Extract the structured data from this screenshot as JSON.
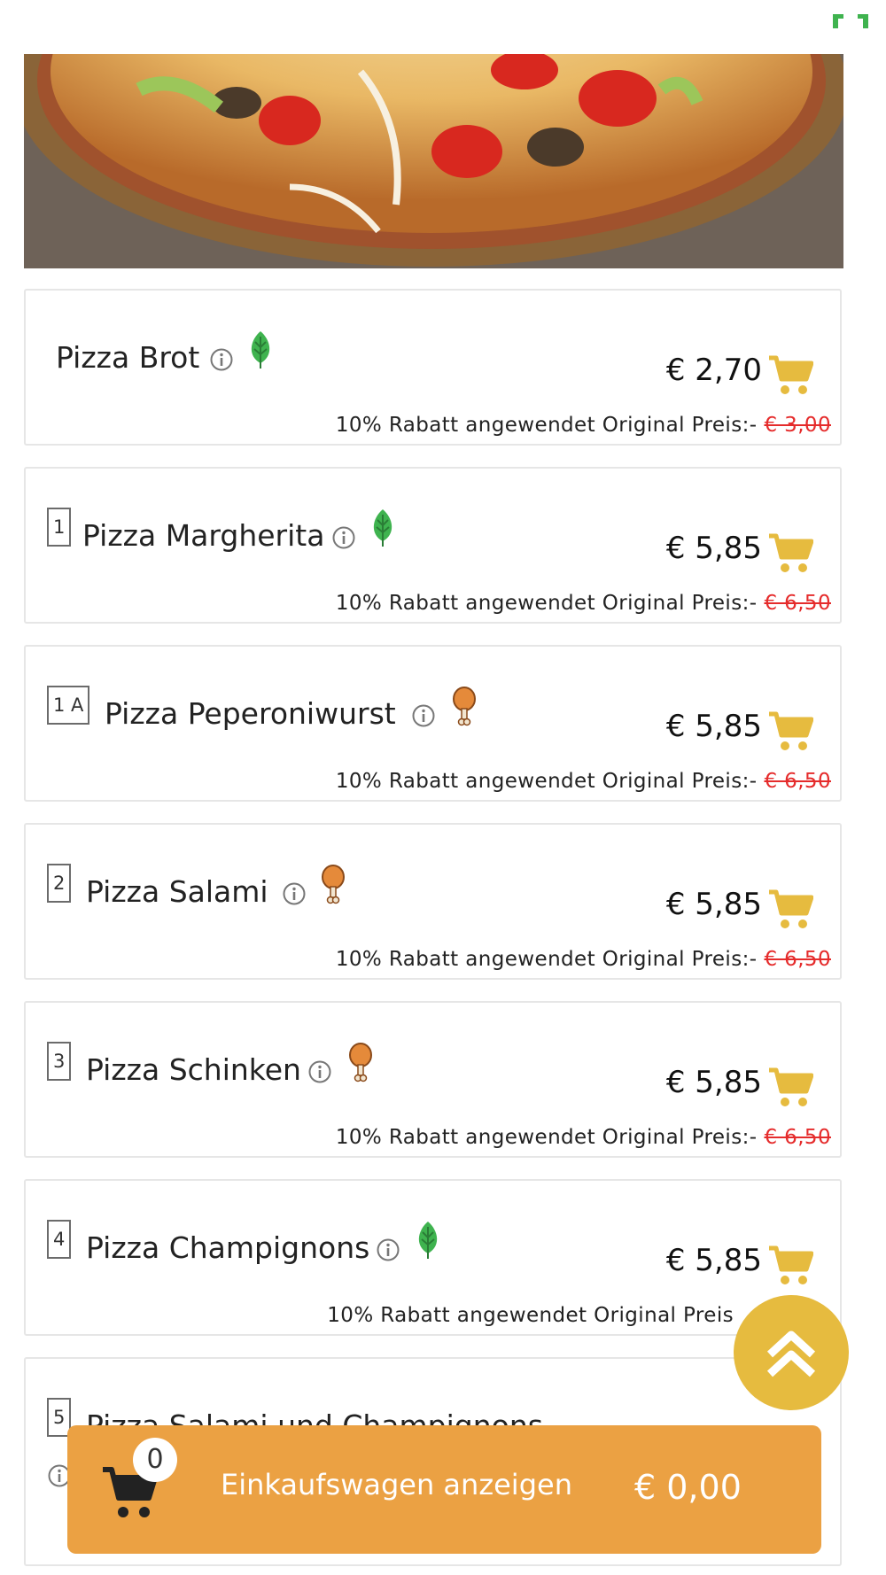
{
  "colors": {
    "accent_cart": "#e6bb3f",
    "cart_bar": "#eba143",
    "strike_red": "#e52b2b",
    "veg_green": "#3fb34f",
    "meat_orange": "#e58a3a"
  },
  "header": {
    "fullscreen_icon": "expand-icon"
  },
  "hero": {
    "image": "pizza-photo"
  },
  "items": [
    {
      "number": "",
      "name": "Pizza Brot",
      "diet_icon": "leaf-icon",
      "price": "€ 2,70",
      "discount_text": "10% Rabatt angewendet Original Preis:-",
      "original_price": "€ 3,00"
    },
    {
      "number": "1",
      "name": "Pizza Margherita",
      "diet_icon": "leaf-icon",
      "price": "€ 5,85",
      "discount_text": "10% Rabatt angewendet Original Preis:-",
      "original_price": "€ 6,50"
    },
    {
      "number": "1 A",
      "name": "Pizza Peperoniwurst",
      "diet_icon": "drumstick-icon",
      "price": "€ 5,85",
      "discount_text": "10% Rabatt angewendet Original Preis:-",
      "original_price": "€ 6,50"
    },
    {
      "number": "2",
      "name": "Pizza Salami",
      "diet_icon": "drumstick-icon",
      "price": "€ 5,85",
      "discount_text": "10% Rabatt angewendet Original Preis:-",
      "original_price": "€ 6,50"
    },
    {
      "number": "3",
      "name": "Pizza Schinken",
      "diet_icon": "drumstick-icon",
      "price": "€ 5,85",
      "discount_text": "10% Rabatt angewendet Original Preis:-",
      "original_price": "€ 6,50"
    },
    {
      "number": "4",
      "name": "Pizza Champignons",
      "diet_icon": "leaf-icon",
      "price": "€ 5,85",
      "discount_text": "10% Rabatt angewendet Original Preis",
      "original_price": ""
    },
    {
      "number": "5",
      "name": "Pizza Salami und Champignons",
      "diet_icon": "",
      "price": "",
      "discount_text": "",
      "original_price": ""
    }
  ],
  "scroll_top": {
    "icon": "double-chevron-up-icon"
  },
  "cart_bar": {
    "count": "0",
    "label": "Einkaufswagen anzeigen",
    "total": "€ 0,00"
  }
}
